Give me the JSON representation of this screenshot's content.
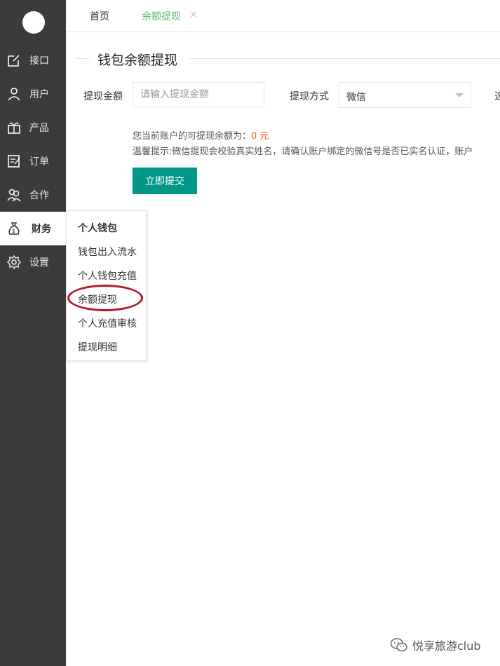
{
  "sidebar": {
    "items": [
      {
        "label": "接口",
        "icon": "edit-icon"
      },
      {
        "label": "用户",
        "icon": "user-icon"
      },
      {
        "label": "产品",
        "icon": "gift-icon"
      },
      {
        "label": "订单",
        "icon": "form-icon"
      },
      {
        "label": "合作",
        "icon": "group-icon"
      },
      {
        "label": "财务",
        "icon": "money-bag-icon"
      },
      {
        "label": "设置",
        "icon": "gear-icon"
      }
    ],
    "active": "财务"
  },
  "tabs": {
    "home": "首页",
    "current": "余额提现",
    "close": "×"
  },
  "page": {
    "title": "钱包余额提现"
  },
  "form": {
    "amount_label": "提现金额",
    "amount_placeholder": "请输入提现金额",
    "method_label": "提现方式",
    "method_value": "微信",
    "cut_label": "选",
    "balance_prefix": "您当前账户的可提现余额为：",
    "balance_amount": "0 元",
    "tip": "温馨提示:微信提现会校验真实姓名，请确认账户绑定的微信号是否已实名认证，账户",
    "submit_label": "立即提交"
  },
  "submenu": {
    "header": "个人钱包",
    "items": [
      "钱包出入流水",
      "个人钱包充值",
      "余额提现",
      "个人充值审核",
      "提现明细"
    ]
  },
  "watermark": {
    "text": "悦享旅游club"
  },
  "colors": {
    "sidebar_bg": "#3b3b3b",
    "accent": "#009688",
    "tab_active": "#5fb878",
    "balance": "#ff5722",
    "circle": "#b5182a"
  }
}
